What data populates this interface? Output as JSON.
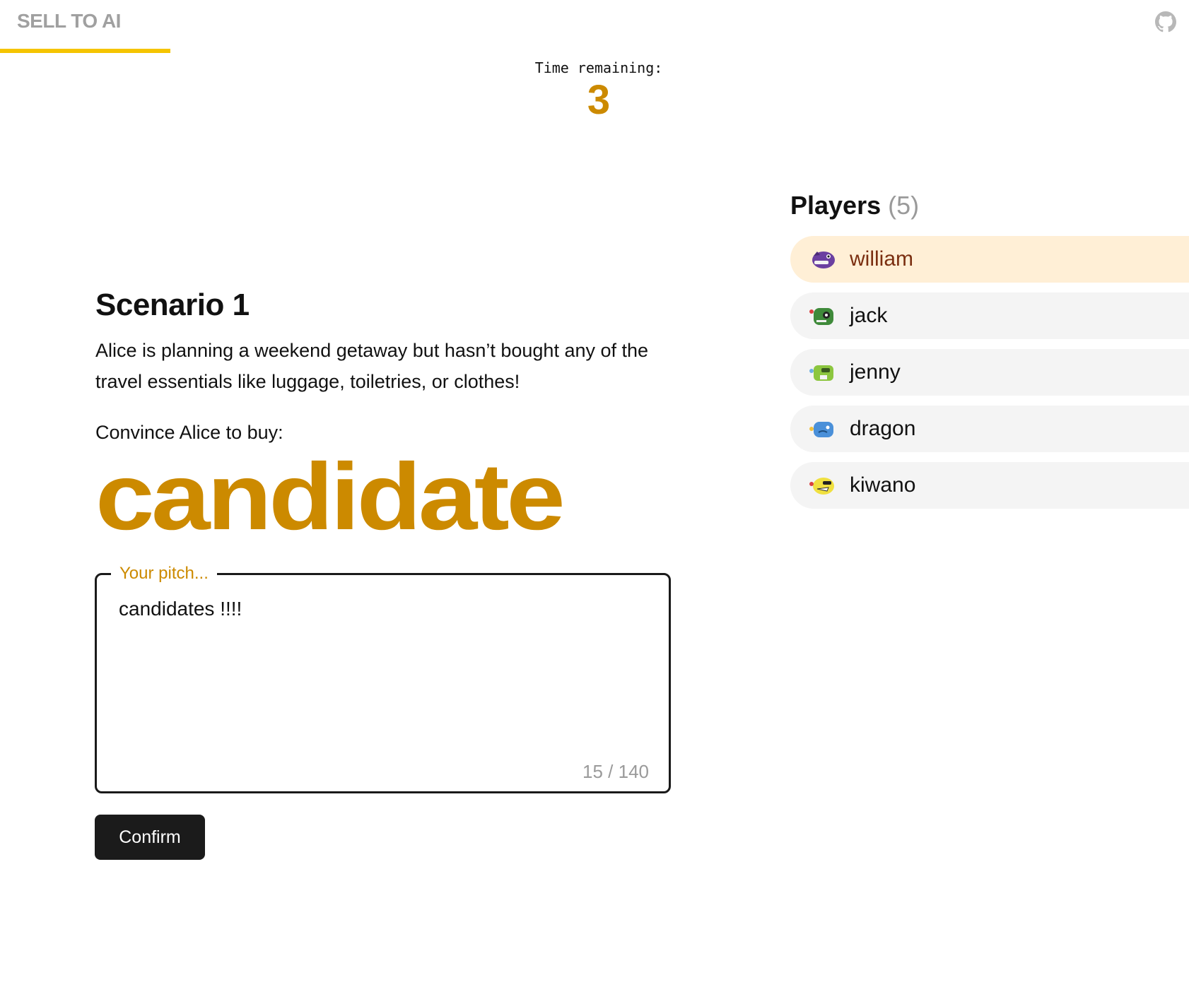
{
  "header": {
    "brand": "SELL TO AI",
    "github_icon": "github-icon"
  },
  "timer": {
    "label": "Time remaining:",
    "value": "3"
  },
  "scenario": {
    "title": "Scenario 1",
    "description": "Alice is planning a weekend getaway but hasn’t bought any of the travel essentials like luggage, toiletries, or clothes!",
    "convince_label": "Convince Alice to buy:",
    "product": "candidate"
  },
  "pitch": {
    "legend": "Your pitch...",
    "value": "candidates !!!!",
    "counter": "15 / 140"
  },
  "confirm_label": "Confirm",
  "players": {
    "title": "Players",
    "count": "(5)",
    "list": [
      {
        "name": "william",
        "active": true,
        "avatar_color": "#6b3fa0",
        "avatar_icon": "purple-monster-icon"
      },
      {
        "name": "jack",
        "active": false,
        "avatar_color": "#3f8a3a",
        "avatar_icon": "green-monster-icon"
      },
      {
        "name": "jenny",
        "active": false,
        "avatar_color": "#8cc63f",
        "avatar_icon": "lime-monster-icon"
      },
      {
        "name": "dragon",
        "active": false,
        "avatar_color": "#4a90d9",
        "avatar_icon": "blue-monster-icon"
      },
      {
        "name": "kiwano",
        "active": false,
        "avatar_color": "#f0e040",
        "avatar_icon": "yellow-monster-icon"
      }
    ]
  },
  "colors": {
    "accent": "#cc8a00",
    "brand_underline": "#f5c400",
    "active_player_bg": "#ffefd6",
    "player_bg": "#f4f4f4"
  }
}
